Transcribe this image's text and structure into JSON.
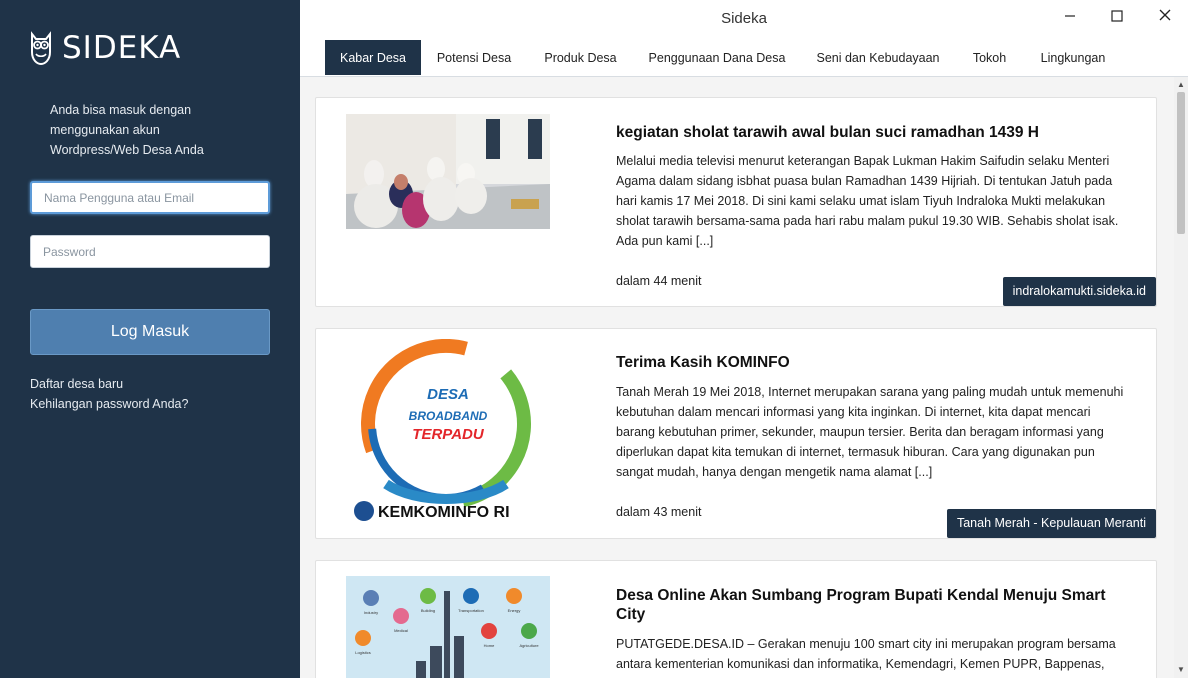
{
  "app": {
    "brand": "SIDEKA",
    "window_title": "Sideka"
  },
  "sidebar": {
    "intro": "Anda bisa masuk dengan menggunakan akun Wordpress/Web Desa Anda",
    "username_placeholder": "Nama Pengguna atau Email",
    "password_placeholder": "Password",
    "login_label": "Log Masuk",
    "register_link": "Daftar desa baru",
    "forgot_link": "Kehilangan password Anda?"
  },
  "tabs": [
    {
      "label": "Kabar Desa",
      "active": true
    },
    {
      "label": "Potensi Desa",
      "active": false
    },
    {
      "label": "Produk Desa",
      "active": false
    },
    {
      "label": "Penggunaan Dana Desa",
      "active": false
    },
    {
      "label": "Seni dan Kebudayaan",
      "active": false
    },
    {
      "label": "Tokoh",
      "active": false
    },
    {
      "label": "Lingkungan",
      "active": false
    }
  ],
  "articles": [
    {
      "title": "kegiatan sholat tarawih awal bulan suci ramadhan 1439 H",
      "excerpt": "Melalui media televisi menurut keterangan Bapak Lukman Hakim Saifudin selaku Menteri Agama dalam sidang isbhat puasa bulan Ramadhan 1439 Hijriah. Di tentukan Jatuh pada hari kamis 17 Mei 2018. Di sini kami selaku umat islam Tiyuh Indraloka Mukti melakukan sholat tarawih bersama-sama pada hari rabu malam pukul 19.30 WIB. Sehabis sholat isak. Ada pun kami [...]",
      "time": "dalam 44 menit",
      "source": "indralokamukti.sideka.id"
    },
    {
      "title": "Terima Kasih KOMINFO",
      "excerpt": "Tanah Merah 19 Mei 2018, Internet merupakan sarana yang paling mudah untuk memenuhi kebutuhan dalam mencari informasi yang kita inginkan. Di internet, kita dapat mencari barang kebutuhan primer, sekunder, maupun tersier. Berita dan beragam informasi yang diperlukan dapat kita temukan di internet, termasuk hiburan. Cara yang digunakan pun sangat mudah, hanya dengan mengetik nama alamat [...]",
      "time": "dalam 43 menit",
      "source": "Tanah Merah - Kepulauan Meranti",
      "logo_text": {
        "line1": "DESA",
        "line2": "BROADBAND",
        "line3": "TERPADU",
        "footer": "KEMKOMINFO RI"
      }
    },
    {
      "title": "Desa Online Akan Sumbang Program Bupati Kendal Menuju Smart City",
      "excerpt": "PUTATGEDE.DESA.ID – Gerakan menuju 100 smart city ini merupakan program bersama antara kementerian komunikasi dan informatika, Kemendagri, Kemen PUPR, Bappenas,",
      "illustration_labels": [
        "Industry",
        "Building",
        "Transportation",
        "Energy",
        "Medical",
        "Home",
        "Agriculture",
        "Logistics"
      ]
    }
  ],
  "colors": {
    "sidebar_bg": "#1f3348",
    "button_bg": "#4f7faf",
    "tab_active_bg": "#1f3348",
    "content_bg": "#f4f4f4"
  }
}
